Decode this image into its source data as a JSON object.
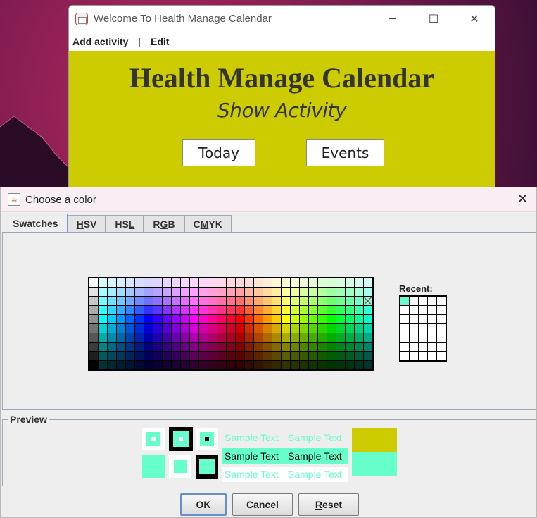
{
  "app": {
    "title": "Welcome To Health Manage Calendar",
    "menu": [
      "Add activity",
      "|",
      "Edit"
    ],
    "heading": "Health Manage Calendar",
    "subheading": "Show Activity",
    "buttons": {
      "today": "Today",
      "events": "Events"
    },
    "background_color": "#cccc00"
  },
  "dialog": {
    "title": "Choose a color",
    "close_glyph": "✕",
    "tabs": [
      {
        "label": "Swatches",
        "mnemonic": "S",
        "active": true
      },
      {
        "label": "HSV",
        "mnemonic": "H"
      },
      {
        "label": "HSL",
        "mnemonic": "L"
      },
      {
        "label": "RGB",
        "mnemonic": "G"
      },
      {
        "label": "CMYK",
        "mnemonic": "M"
      }
    ],
    "recent_label": "Recent:",
    "recent_colors": [
      "#66ffcc"
    ],
    "selected_color": "#66ffcc",
    "preview": {
      "label": "Preview",
      "sample_text": "Sample Text",
      "previous_color": "#cccc00"
    },
    "buttons": {
      "ok": "OK",
      "cancel": "Cancel",
      "reset": "Reset"
    }
  }
}
